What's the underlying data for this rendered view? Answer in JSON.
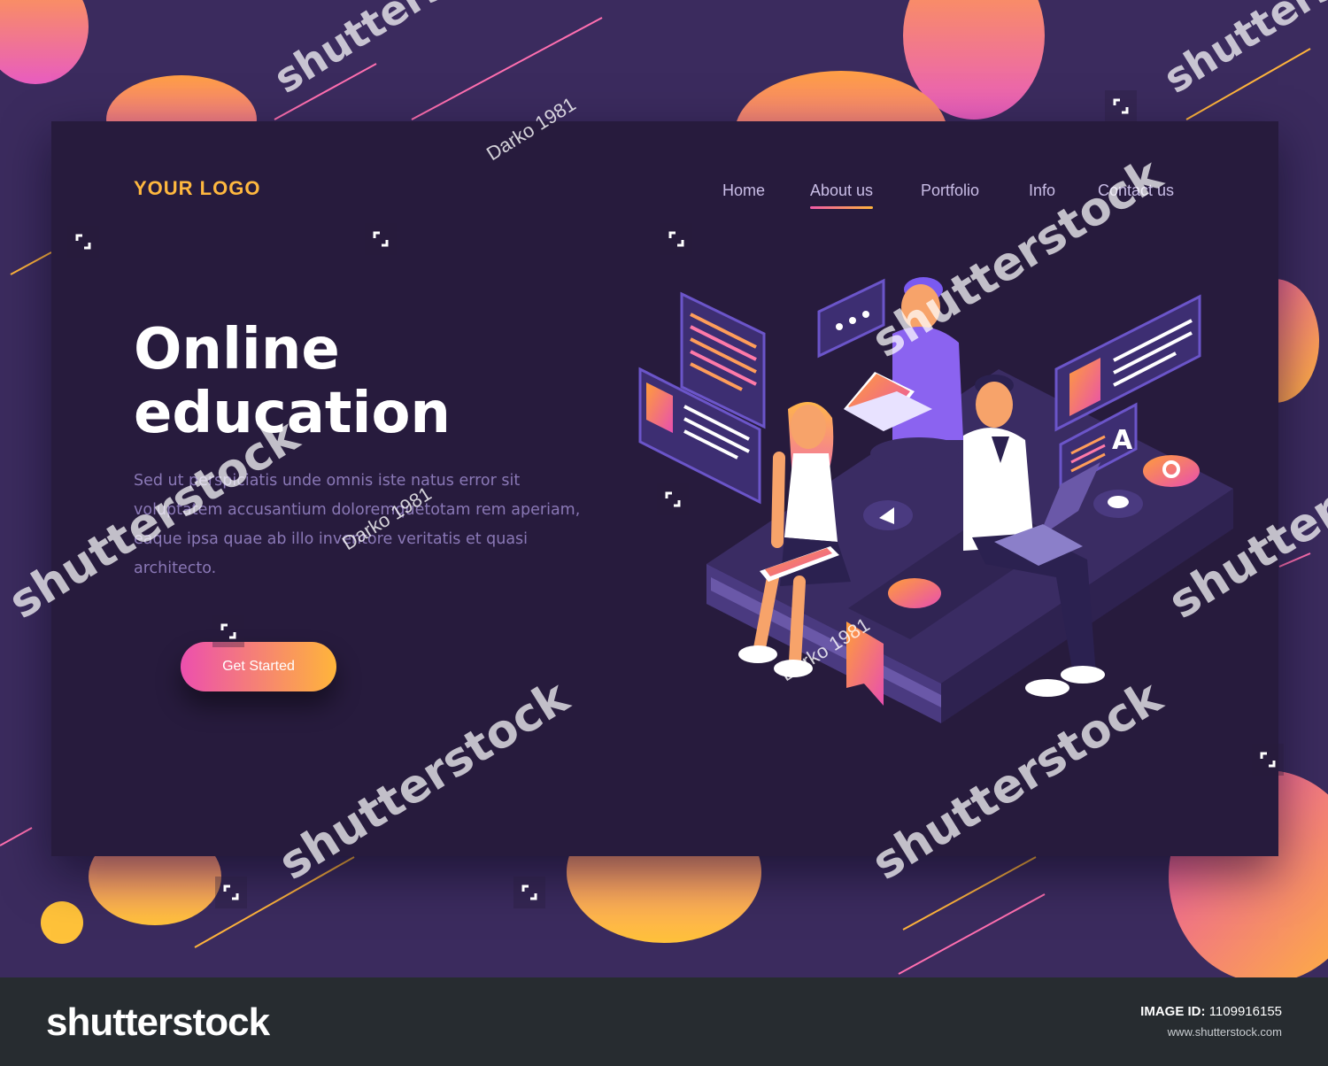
{
  "header": {
    "logo": "YOUR LOGO",
    "nav": [
      {
        "label": "Home"
      },
      {
        "label": "About us",
        "active": true
      },
      {
        "label": "Portfolio"
      },
      {
        "label": "Info"
      },
      {
        "label": "Contact us"
      }
    ]
  },
  "hero": {
    "title_line1": "Online",
    "title_line2": "education",
    "body": "Sed ut perspiciatis unde omnis iste natus error sit voluptatem accusantium doloremquetotam rem aperiam, eaque ipsa quae ab illo inventore veritatis et quasi architecto.",
    "cta_label": "Get Started"
  },
  "watermark": {
    "brand": "shutterstock",
    "artist": "Darko 1981"
  },
  "footer": {
    "brand": "shutterstock",
    "image_id_label": "IMAGE ID:",
    "image_id": "1109916155",
    "url": "www.shutterstock.com"
  },
  "colors": {
    "background": "#3b2b5e",
    "card": "#271b3d",
    "accent_orange": "#ffb83f",
    "accent_pink": "#ec4fae",
    "nav_text": "#c9bde6",
    "body_text": "#8a78b6"
  }
}
